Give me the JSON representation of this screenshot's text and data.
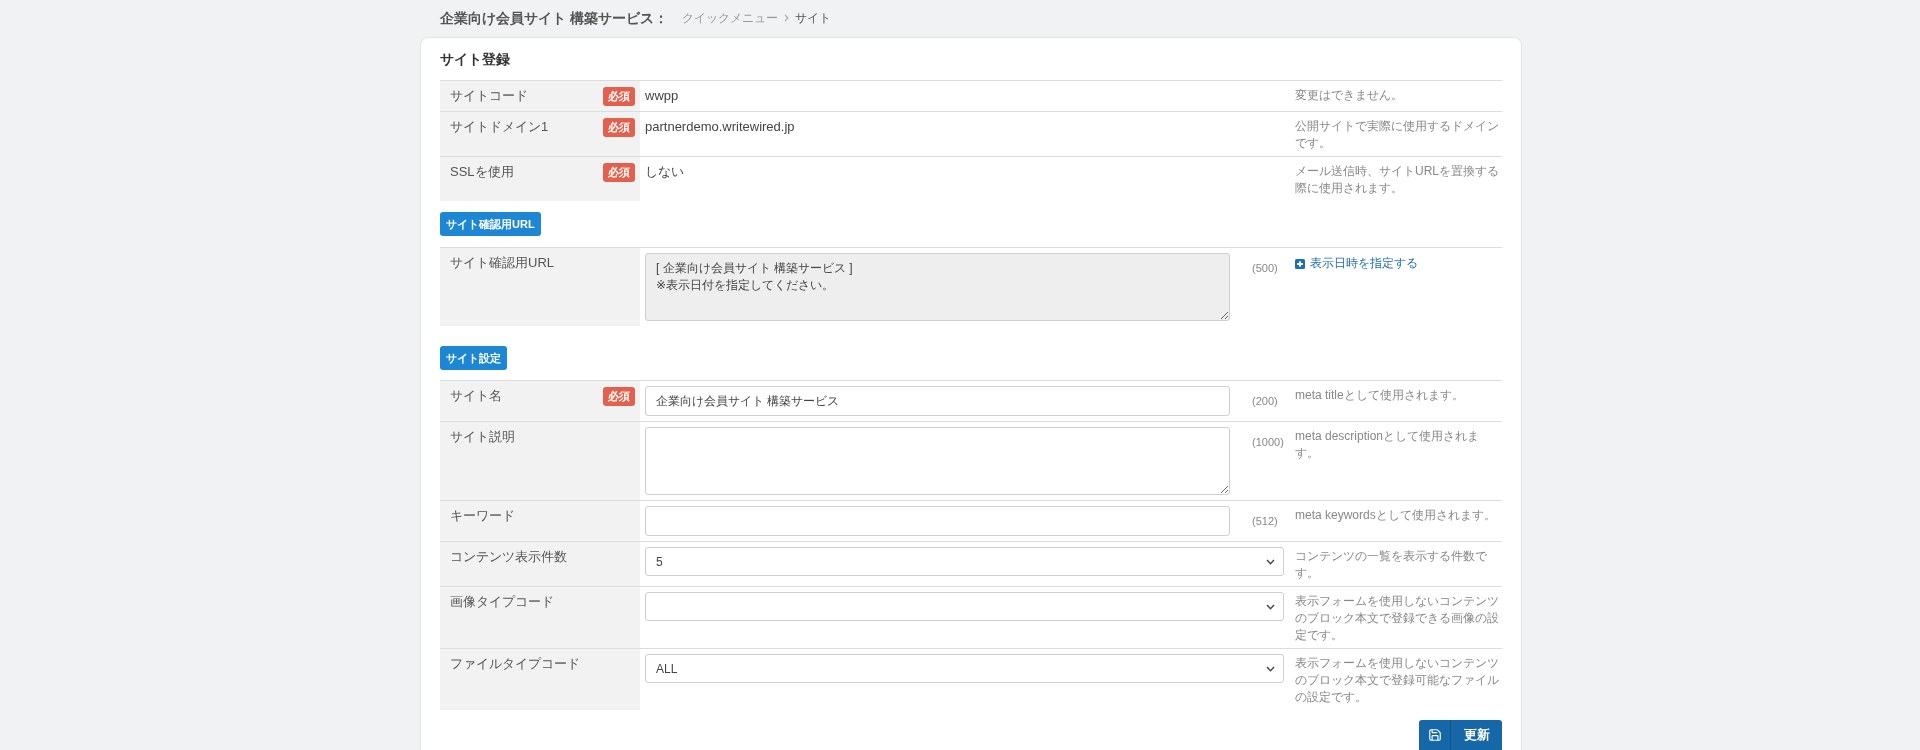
{
  "header": {
    "title": "企業向け会員サイト 構築サービス：",
    "breadcrumb": [
      {
        "label": "クイックメニュー",
        "selected": false
      },
      {
        "label": "サイト",
        "selected": true
      }
    ]
  },
  "card": {
    "title": "サイト登録",
    "sections": [
      {
        "rows": [
          {
            "kind": "text",
            "label": "サイトコード",
            "tag": "必須",
            "value": "wwpp",
            "note": "変更はできません。"
          },
          {
            "kind": "text",
            "label": "サイトドメイン1",
            "tag": "必須",
            "value": "partnerdemo.writewired.jp",
            "note": "公開サイトで実際に使用するドメインです。"
          },
          {
            "kind": "text",
            "label": "SSLを使用",
            "tag": "必須",
            "value": "しない",
            "note": "メール送信時、サイトURLを置換する際に使用されます。"
          }
        ]
      },
      {
        "heading": "サイト確認用URL",
        "rows": [
          {
            "kind": "textarea",
            "label": "サイト確認用URL",
            "readonly": true,
            "value": "[ 企業向け会員サイト 構築サービス ]\n※表示日付を指定してください。",
            "count": "(500)",
            "link": "表示日時を指定する"
          }
        ]
      },
      {
        "heading": "サイト設定",
        "rows": [
          {
            "kind": "input",
            "label": "サイト名",
            "tag": "必須",
            "readonly": false,
            "value": "企業向け会員サイト 構築サービス",
            "count": "(200)",
            "note": "meta titleとして使用されます。"
          },
          {
            "kind": "textarea",
            "label": "サイト説明",
            "readonly": false,
            "count": "(1000)",
            "note": "meta descriptionとして使用されます。"
          },
          {
            "kind": "input",
            "label": "キーワード",
            "readonly": false,
            "count": "(512)",
            "note": "meta keywordsとして使用されます。"
          },
          {
            "kind": "select",
            "label": "コンテンツ表示件数",
            "value": "5",
            "note": "コンテンツの一覧を表示する件数です。"
          },
          {
            "kind": "select",
            "label": "画像タイプコード",
            "note": "表示フォームを使用しないコンテンツのブロック本文で登録できる画像の設定です。"
          },
          {
            "kind": "select",
            "label": "ファイルタイプコード",
            "value": "ALL",
            "note": "表示フォームを使用しないコンテンツのブロック本文で登録可能なファイルの設定です。"
          }
        ]
      }
    ]
  },
  "submit": {
    "label": "更新"
  }
}
